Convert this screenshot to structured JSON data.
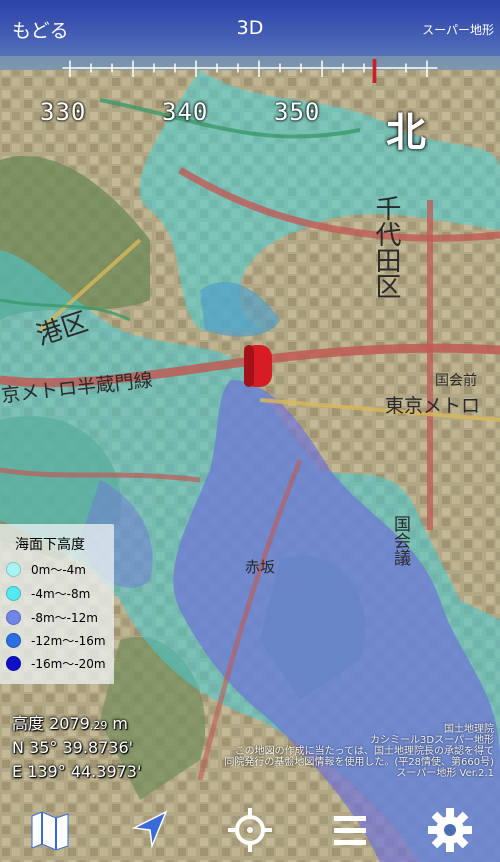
{
  "topbar": {
    "back_label": "もどる",
    "mode_label": "3D",
    "app_name": "スーパー地形"
  },
  "compass": {
    "labels": [
      "330",
      "340",
      "350"
    ],
    "north_label": "北",
    "needle_color": "#c8202a"
  },
  "legend": {
    "title": "海面下高度",
    "items": [
      {
        "label": "0m〜-4m",
        "color": "#a8f4f4"
      },
      {
        "label": "-4m〜-8m",
        "color": "#54e8f0"
      },
      {
        "label": "-8m〜-12m",
        "color": "#6f86e8"
      },
      {
        "label": "-12m〜-16m",
        "color": "#2b6fe0"
      },
      {
        "label": "-16m〜-20m",
        "color": "#1010c8"
      }
    ]
  },
  "readout": {
    "altitude_label": "高度",
    "altitude_int": "2079",
    "altitude_dec": ".29",
    "altitude_unit": "m",
    "lat": "N  35° 39.8736'",
    "lon": "E 139° 44.3973'"
  },
  "map_labels": {
    "district_chiyoda": "千代田区",
    "district_minato": "港区",
    "line_hanzomon": "京メトロ半蔵門線",
    "line_tokyo_metro": "東京メトロ",
    "akasaka": "赤坂",
    "kokkai": "国会議",
    "kokkaimae": "国会前"
  },
  "credit": {
    "line1": "国土地理院",
    "line2": "カシミール3Dスーパー地形",
    "line3": "この地図の作成に当たっては、国土地理院長の承認を得て",
    "line4": "同院発行の基盤地図情報を使用した。(平28情使、第660号)",
    "line5": "スーパー地形 Ver.2.1"
  },
  "bottombar": {
    "map_icon": "map-icon",
    "location_icon": "location-arrow-icon",
    "crosshair_icon": "crosshair-icon",
    "menu_icon": "menu-icon",
    "settings_icon": "gear-icon",
    "accent_color": "#ffffff"
  },
  "marker": {
    "color": "#d81c24"
  }
}
